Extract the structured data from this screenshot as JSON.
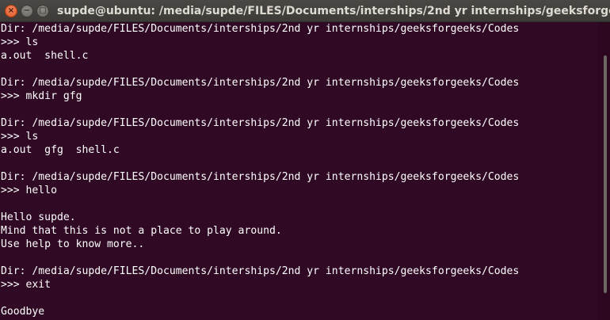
{
  "window": {
    "title": "supde@ubuntu: /media/supde/FILES/Documents/interships/2nd yr internships/geeksforgeeks/",
    "close_glyph": "×",
    "minimize_glyph": "−",
    "maximize_glyph": "□"
  },
  "colors": {
    "terminal_bg": "#300a24",
    "terminal_fg": "#ffffff",
    "titlebar_bg": "#3c3b37",
    "close_button": "#e0541f"
  },
  "terminal": {
    "lines": [
      "Dir: /media/supde/FILES/Documents/interships/2nd yr internships/geeksforgeeks/Codes",
      ">>> ls",
      "a.out  shell.c",
      "",
      "Dir: /media/supde/FILES/Documents/interships/2nd yr internships/geeksforgeeks/Codes",
      ">>> mkdir gfg",
      "",
      "Dir: /media/supde/FILES/Documents/interships/2nd yr internships/geeksforgeeks/Codes",
      ">>> ls",
      "a.out  gfg  shell.c",
      "",
      "Dir: /media/supde/FILES/Documents/interships/2nd yr internships/geeksforgeeks/Codes",
      ">>> hello",
      "",
      "Hello supde.",
      "Mind that this is not a place to play around.",
      "Use help to know more..",
      "",
      "Dir: /media/supde/FILES/Documents/interships/2nd yr internships/geeksforgeeks/Codes",
      ">>> exit",
      "",
      "Goodbye"
    ]
  }
}
